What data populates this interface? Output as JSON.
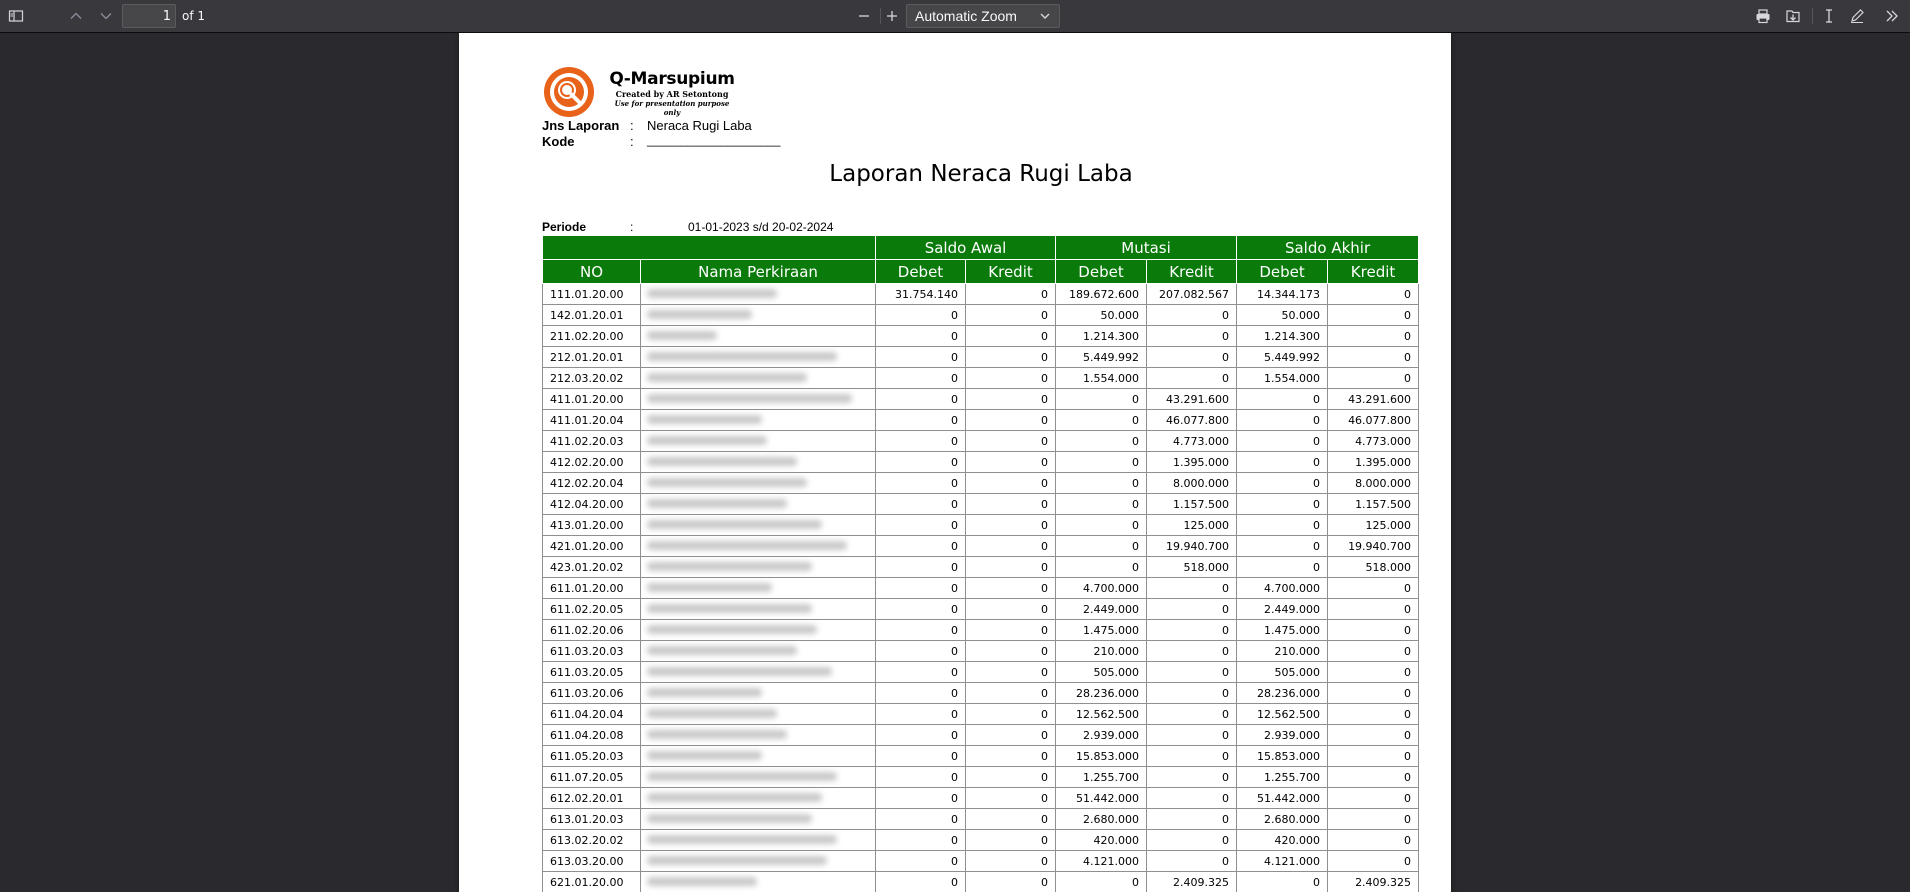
{
  "toolbar": {
    "page_number": "1",
    "page_of": "of 1",
    "zoom": "Automatic Zoom",
    "icons": [
      "sidebar-toggle-icon",
      "previous-page-icon",
      "next-page-icon",
      "zoom-out-icon",
      "zoom-in-icon",
      "print-icon",
      "download-icon",
      "text-select-icon",
      "draw-icon",
      "tools-icon"
    ]
  },
  "brand": {
    "name": "Q-Marsupium",
    "created_by": "Created by AR Setontong",
    "note": "Use for presentation purpose only",
    "accent_color": "#e8621a"
  },
  "meta": {
    "jns_label": "Jns Laporan",
    "jns_colon": ":",
    "jns_value": "Neraca Rugi Laba",
    "kode_label": "Kode",
    "kode_colon": ":",
    "kode_value": "____________________",
    "periode_label": "Periode",
    "periode_colon": ":",
    "periode_value": "01-01-2023 s/d 20-02-2024"
  },
  "report_title": "Laporan Neraca Rugi Laba",
  "table": {
    "header_color": "#0a7a0a",
    "group_headers": [
      "Saldo Awal",
      "Mutasi",
      "Saldo Akhir"
    ],
    "columns": [
      "NO",
      "Nama Perkiraan",
      "Debet",
      "Kredit",
      "Debet",
      "Kredit",
      "Debet",
      "Kredit"
    ],
    "rows": [
      [
        "111.01.20.00",
        "31.754.140",
        "0",
        "189.672.600",
        "207.082.567",
        "14.344.173",
        "0"
      ],
      [
        "142.01.20.01",
        "0",
        "0",
        "50.000",
        "0",
        "50.000",
        "0"
      ],
      [
        "211.02.20.00",
        "0",
        "0",
        "1.214.300",
        "0",
        "1.214.300",
        "0"
      ],
      [
        "212.01.20.01",
        "0",
        "0",
        "5.449.992",
        "0",
        "5.449.992",
        "0"
      ],
      [
        "212.03.20.02",
        "0",
        "0",
        "1.554.000",
        "0",
        "1.554.000",
        "0"
      ],
      [
        "411.01.20.00",
        "0",
        "0",
        "0",
        "43.291.600",
        "0",
        "43.291.600"
      ],
      [
        "411.01.20.04",
        "0",
        "0",
        "0",
        "46.077.800",
        "0",
        "46.077.800"
      ],
      [
        "411.02.20.03",
        "0",
        "0",
        "0",
        "4.773.000",
        "0",
        "4.773.000"
      ],
      [
        "412.02.20.00",
        "0",
        "0",
        "0",
        "1.395.000",
        "0",
        "1.395.000"
      ],
      [
        "412.02.20.04",
        "0",
        "0",
        "0",
        "8.000.000",
        "0",
        "8.000.000"
      ],
      [
        "412.04.20.00",
        "0",
        "0",
        "0",
        "1.157.500",
        "0",
        "1.157.500"
      ],
      [
        "413.01.20.00",
        "0",
        "0",
        "0",
        "125.000",
        "0",
        "125.000"
      ],
      [
        "421.01.20.00",
        "0",
        "0",
        "0",
        "19.940.700",
        "0",
        "19.940.700"
      ],
      [
        "423.01.20.02",
        "0",
        "0",
        "0",
        "518.000",
        "0",
        "518.000"
      ],
      [
        "611.01.20.00",
        "0",
        "0",
        "4.700.000",
        "0",
        "4.700.000",
        "0"
      ],
      [
        "611.02.20.05",
        "0",
        "0",
        "2.449.000",
        "0",
        "2.449.000",
        "0"
      ],
      [
        "611.02.20.06",
        "0",
        "0",
        "1.475.000",
        "0",
        "1.475.000",
        "0"
      ],
      [
        "611.03.20.03",
        "0",
        "0",
        "210.000",
        "0",
        "210.000",
        "0"
      ],
      [
        "611.03.20.05",
        "0",
        "0",
        "505.000",
        "0",
        "505.000",
        "0"
      ],
      [
        "611.03.20.06",
        "0",
        "0",
        "28.236.000",
        "0",
        "28.236.000",
        "0"
      ],
      [
        "611.04.20.04",
        "0",
        "0",
        "12.562.500",
        "0",
        "12.562.500",
        "0"
      ],
      [
        "611.04.20.08",
        "0",
        "0",
        "2.939.000",
        "0",
        "2.939.000",
        "0"
      ],
      [
        "611.05.20.03",
        "0",
        "0",
        "15.853.000",
        "0",
        "15.853.000",
        "0"
      ],
      [
        "611.07.20.05",
        "0",
        "0",
        "1.255.700",
        "0",
        "1.255.700",
        "0"
      ],
      [
        "612.02.20.01",
        "0",
        "0",
        "51.442.000",
        "0",
        "51.442.000",
        "0"
      ],
      [
        "613.01.20.03",
        "0",
        "0",
        "2.680.000",
        "0",
        "2.680.000",
        "0"
      ],
      [
        "613.02.20.02",
        "0",
        "0",
        "420.000",
        "0",
        "420.000",
        "0"
      ],
      [
        "613.03.20.00",
        "0",
        "0",
        "4.121.000",
        "0",
        "4.121.000",
        "0"
      ],
      [
        "621.01.20.00",
        "0",
        "0",
        "0",
        "2.409.325",
        "0",
        "2.409.325"
      ]
    ]
  }
}
